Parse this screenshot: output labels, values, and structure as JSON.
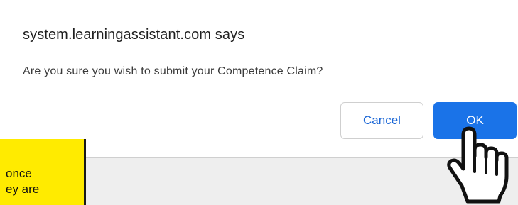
{
  "dialog": {
    "title": "system.learningassistant.com says",
    "message": "Are you sure you wish to submit your Competence Claim?",
    "cancel_label": "Cancel",
    "ok_label": "OK"
  },
  "callout": {
    "text": "once\ney are"
  },
  "cursor": {
    "icon": "hand-pointer-icon"
  },
  "colors": {
    "ok_button": "#1a73e8",
    "cancel_text": "#1a66d6",
    "callout_bg": "#ffeb00"
  }
}
